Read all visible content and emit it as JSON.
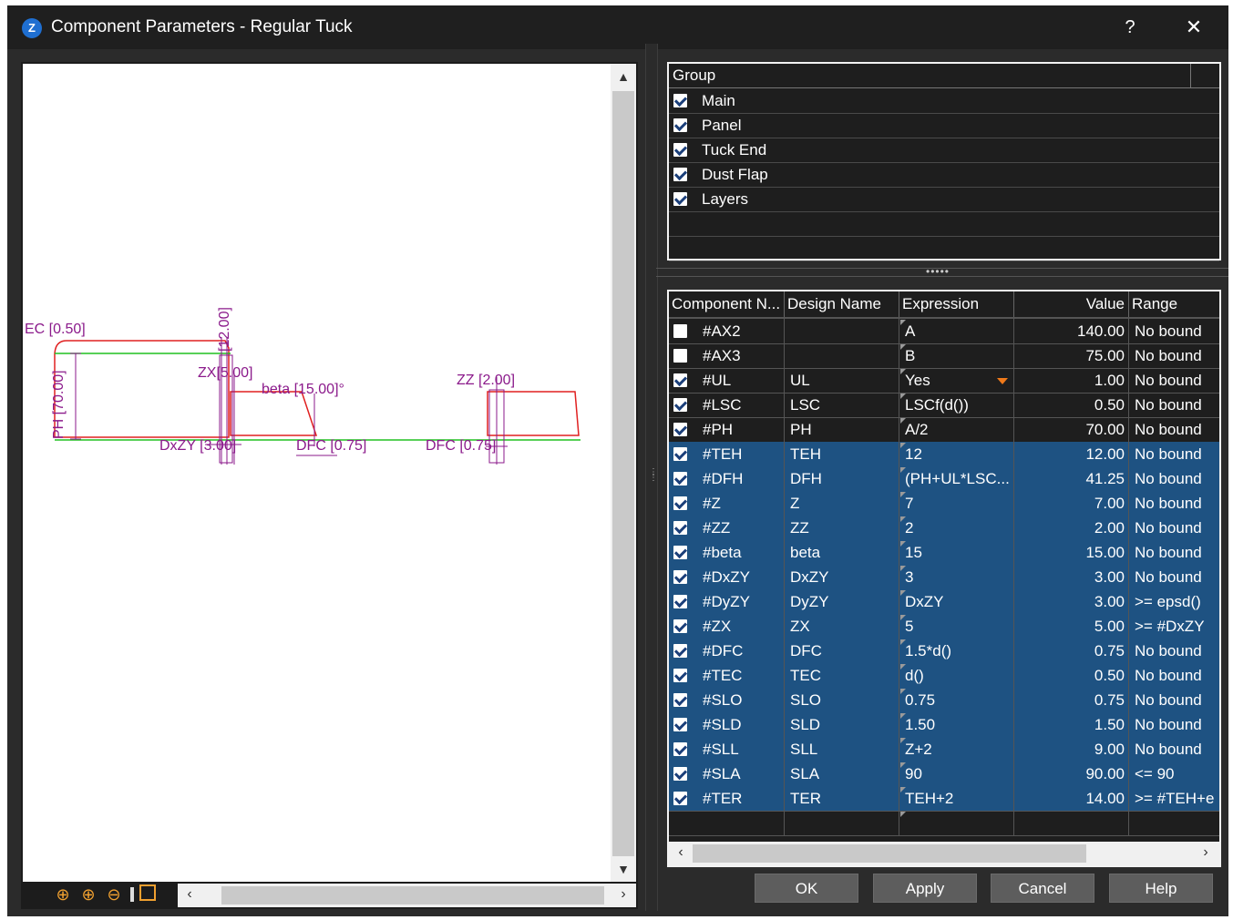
{
  "window": {
    "title": "Component Parameters - Regular Tuck",
    "app_icon": "Z",
    "help_label": "?",
    "close_label": "✕"
  },
  "preview": {
    "labels": [
      "EC [0.50]",
      "PH [70.00]",
      "[12.00]",
      "ZX[5.00]",
      "beta [15.00]°",
      "DxZY [3.00]",
      "DFC [0.75]",
      "ZZ [2.00]",
      "DFC [0.75]"
    ],
    "zoom_icons": [
      "zoom-extents-icon",
      "zoom-in-icon",
      "zoom-out-icon",
      "fit-window-icon"
    ]
  },
  "group": {
    "header": "Group",
    "items": [
      {
        "label": "Main",
        "checked": true
      },
      {
        "label": "Panel",
        "checked": true
      },
      {
        "label": "Tuck End",
        "checked": true
      },
      {
        "label": "Dust Flap",
        "checked": true
      },
      {
        "label": "Layers",
        "checked": true
      }
    ]
  },
  "grid": {
    "columns": [
      "Component N...",
      "Design Name",
      "Expression",
      "Value",
      "Range"
    ],
    "rows": [
      {
        "checked": false,
        "name": "#AX2",
        "design": "",
        "expr": "A",
        "value": "140.00",
        "range": "No bound",
        "selected": false
      },
      {
        "checked": false,
        "name": "#AX3",
        "design": "",
        "expr": "B",
        "value": "75.00",
        "range": "No bound",
        "selected": false
      },
      {
        "checked": true,
        "name": "#UL",
        "design": "UL",
        "expr": "Yes",
        "value": "1.00",
        "range": "No bound",
        "selected": false,
        "dropdown": true
      },
      {
        "checked": true,
        "name": "#LSC",
        "design": "LSC",
        "expr": "LSCf(d())",
        "value": "0.50",
        "range": "No bound",
        "selected": false
      },
      {
        "checked": true,
        "name": "#PH",
        "design": "PH",
        "expr": "A/2",
        "value": "70.00",
        "range": "No bound",
        "selected": false
      },
      {
        "checked": true,
        "name": "#TEH",
        "design": "TEH",
        "expr": "12",
        "value": "12.00",
        "range": "No bound",
        "selected": true
      },
      {
        "checked": true,
        "name": "#DFH",
        "design": "DFH",
        "expr": "(PH+UL*LSC...",
        "value": "41.25",
        "range": "No bound",
        "selected": true
      },
      {
        "checked": true,
        "name": "#Z",
        "design": "Z",
        "expr": "7",
        "value": "7.00",
        "range": "No bound",
        "selected": true
      },
      {
        "checked": true,
        "name": "#ZZ",
        "design": "ZZ",
        "expr": "2",
        "value": "2.00",
        "range": "No bound",
        "selected": true
      },
      {
        "checked": true,
        "name": "#beta",
        "design": "beta",
        "expr": "15",
        "value": "15.00",
        "range": "No bound",
        "selected": true
      },
      {
        "checked": true,
        "name": "#DxZY",
        "design": "DxZY",
        "expr": "3",
        "value": "3.00",
        "range": "No bound",
        "selected": true
      },
      {
        "checked": true,
        "name": "#DyZY",
        "design": "DyZY",
        "expr": "DxZY",
        "value": "3.00",
        "range": ">= epsd()",
        "selected": true
      },
      {
        "checked": true,
        "name": "#ZX",
        "design": "ZX",
        "expr": "5",
        "value": "5.00",
        "range": ">= #DxZY",
        "selected": true
      },
      {
        "checked": true,
        "name": "#DFC",
        "design": "DFC",
        "expr": "1.5*d()",
        "value": "0.75",
        "range": "No bound",
        "selected": true
      },
      {
        "checked": true,
        "name": "#TEC",
        "design": "TEC",
        "expr": "d()",
        "value": "0.50",
        "range": "No bound",
        "selected": true
      },
      {
        "checked": true,
        "name": "#SLO",
        "design": "SLO",
        "expr": "0.75",
        "value": "0.75",
        "range": "No bound",
        "selected": true
      },
      {
        "checked": true,
        "name": "#SLD",
        "design": "SLD",
        "expr": "1.50",
        "value": "1.50",
        "range": "No bound",
        "selected": true
      },
      {
        "checked": true,
        "name": "#SLL",
        "design": "SLL",
        "expr": "Z+2",
        "value": "9.00",
        "range": "No bound",
        "selected": true
      },
      {
        "checked": true,
        "name": "#SLA",
        "design": "SLA",
        "expr": "90",
        "value": "90.00",
        "range": "<= 90",
        "selected": true
      },
      {
        "checked": true,
        "name": "#TER",
        "design": "TER",
        "expr": "TEH+2",
        "value": "14.00",
        "range": ">= #TEH+e",
        "selected": true
      }
    ]
  },
  "buttons": {
    "ok": "OK",
    "apply": "Apply",
    "cancel": "Cancel",
    "help": "Help"
  },
  "colors": {
    "selection": "#1e5282",
    "drawing_outline": "#e02020",
    "drawing_fold": "#20c020",
    "dimension": "#8b1a8b",
    "accent": "#f07a1a"
  }
}
